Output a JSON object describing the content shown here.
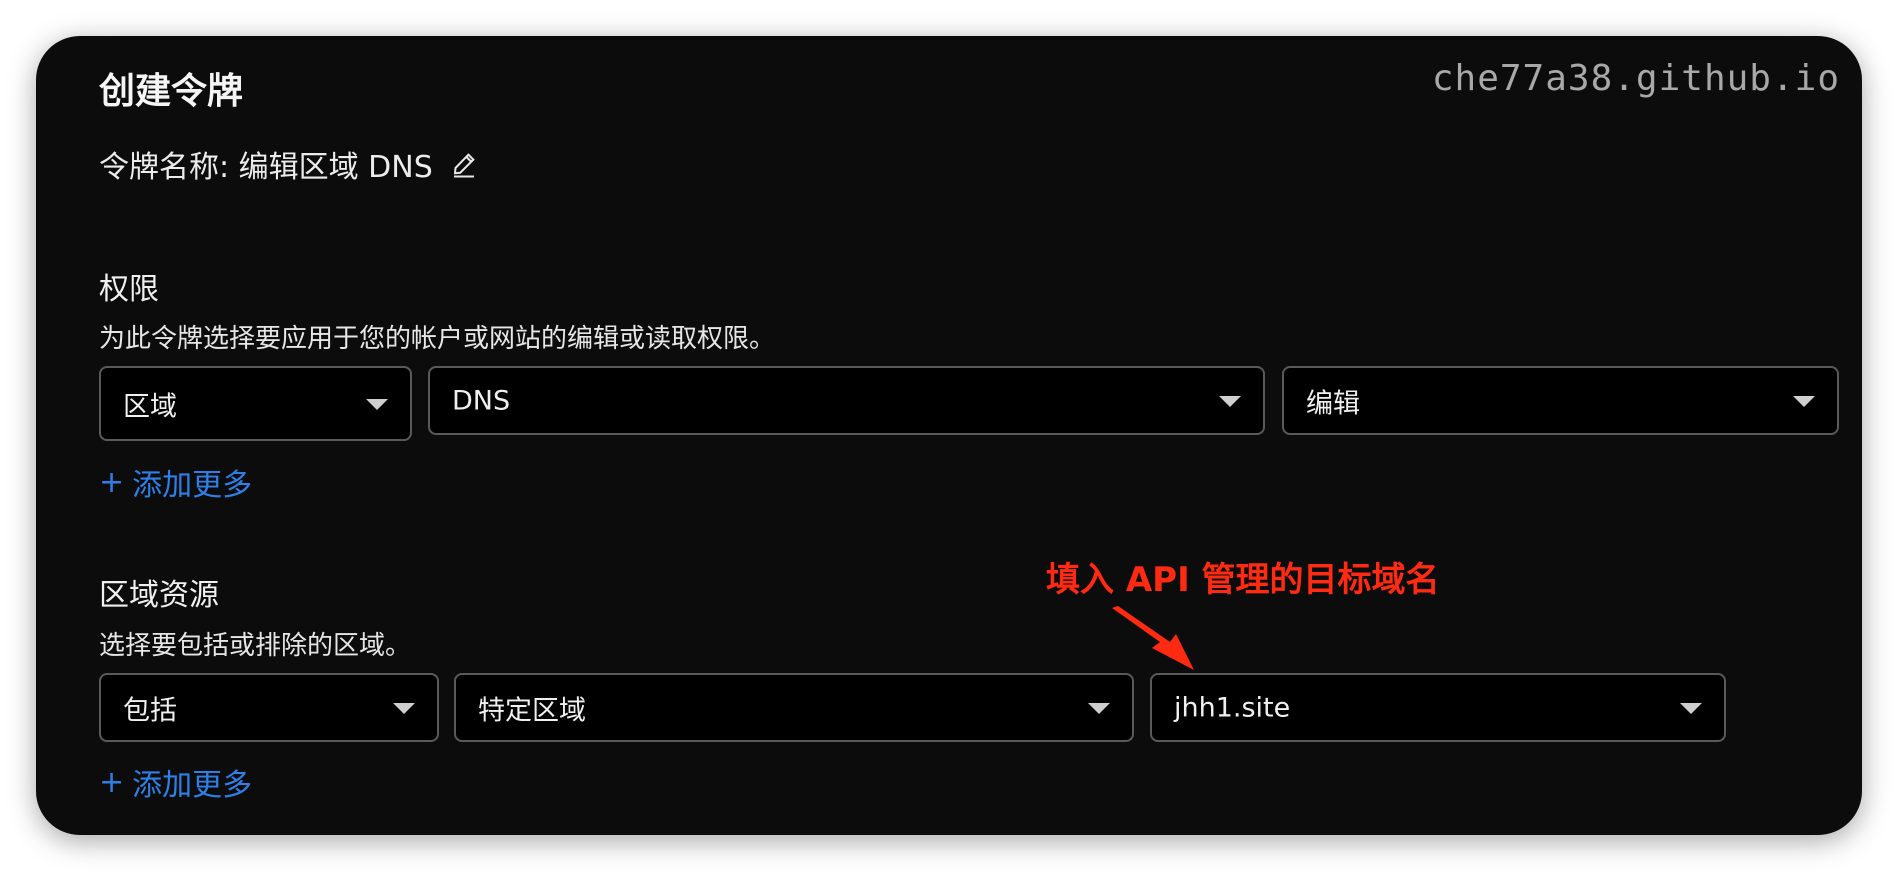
{
  "watermark": "che77a38.github.io",
  "title": "创建令牌",
  "token_name": {
    "label": "令牌名称: 编辑区域 DNS"
  },
  "permissions": {
    "title": "权限",
    "description": "为此令牌选择要应用于您的帐户或网站的编辑或读取权限。",
    "selects": [
      "区域",
      "DNS",
      "编辑"
    ],
    "add_more": "添加更多"
  },
  "zone_resources": {
    "title": "区域资源",
    "description": "选择要包括或排除的区域。",
    "selects": [
      "包括",
      "特定区域",
      "jhh1.site"
    ],
    "add_more": "添加更多"
  },
  "annotation": "填入 API 管理的目标域名",
  "colors": {
    "background": "#0c0c0c",
    "link": "#2f7fe8",
    "annotation": "#ff2a12",
    "border": "#5a5a5a"
  }
}
